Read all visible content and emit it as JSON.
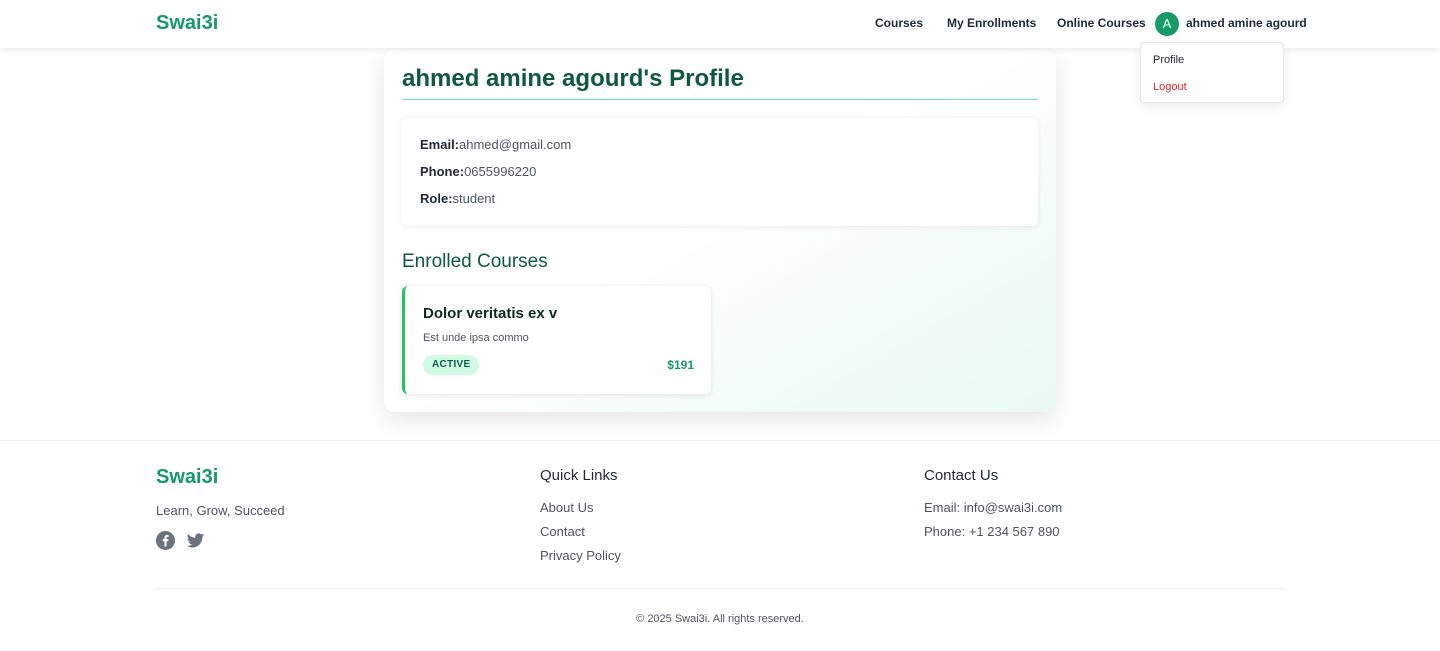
{
  "header": {
    "brand": "Swai3i",
    "nav": {
      "courses": "Courses",
      "enrollments": "My Enrollments",
      "online_courses": "Online Courses"
    },
    "avatar_initial": "A",
    "username": "ahmed amine agourd"
  },
  "user_menu": {
    "profile": "Profile",
    "logout": "Logout"
  },
  "profile": {
    "title": "ahmed amine agourd's Profile",
    "email_label": "Email:",
    "email": "ahmed@gmail.com",
    "phone_label": "Phone:",
    "phone": "0655996220",
    "role_label": "Role:",
    "role": "student"
  },
  "enrolled": {
    "heading": "Enrolled Courses",
    "courses": [
      {
        "title": "Dolor veritatis ex v",
        "description": "Est unde ipsa commo",
        "status": "ACTIVE",
        "price": "$191"
      }
    ]
  },
  "footer": {
    "brand": "Swai3i",
    "tagline": "Learn, Grow, Succeed",
    "social_icons": [
      "facebook-icon",
      "twitter-icon"
    ],
    "quick_links_title": "Quick Links",
    "quick_links": [
      "About Us",
      "Contact",
      "Privacy Policy"
    ],
    "contact_title": "Contact Us",
    "contact_email": "Email: info@swai3i.com",
    "contact_phone": "Phone: +1 234 567 890",
    "copyright": "© 2025 Swai3i. All rights reserved."
  },
  "colors": {
    "brand_green": "#159a6a",
    "heading_green": "#0f5a3f",
    "logout_red": "#dc2626",
    "badge_bg": "#d1fae5"
  }
}
